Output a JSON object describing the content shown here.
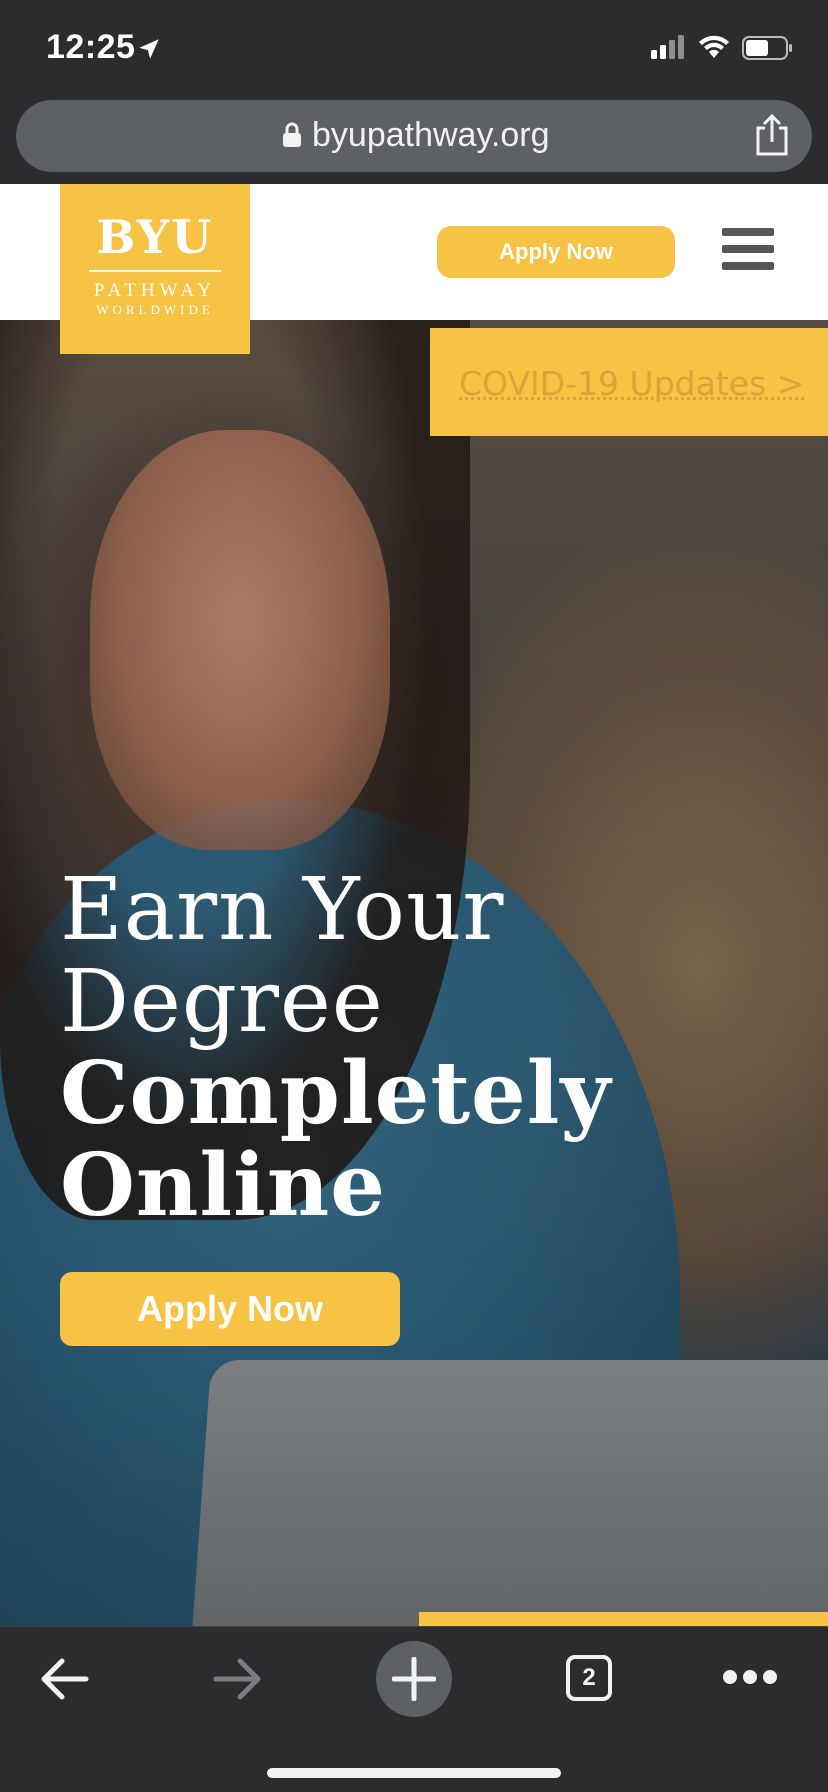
{
  "status_bar": {
    "time": "12:25"
  },
  "address_bar": {
    "url": "byupathway.org"
  },
  "logo": {
    "line1": "BYU",
    "line2": "PATHWAY",
    "line3": "WORLDWIDE"
  },
  "header": {
    "apply_label": "Apply Now"
  },
  "covid": {
    "label": "COVID-19 Updates >"
  },
  "hero": {
    "headline_light_1": "Earn Your",
    "headline_light_2": "Degree",
    "headline_bold_1": "Completely",
    "headline_bold_2": "Online",
    "apply_label": "Apply Now"
  },
  "toolbar": {
    "tab_count": "2"
  },
  "colors": {
    "accent": "#f6c344",
    "chrome": "#2b2c2e",
    "address_bg": "#5d6064"
  },
  "icons": [
    "location-arrow-icon",
    "signal-icon",
    "wifi-icon",
    "battery-icon",
    "lock-icon",
    "share-icon",
    "hamburger-menu-icon",
    "back-arrow-icon",
    "forward-arrow-icon",
    "new-tab-plus-icon",
    "tabs-icon",
    "more-icon"
  ]
}
